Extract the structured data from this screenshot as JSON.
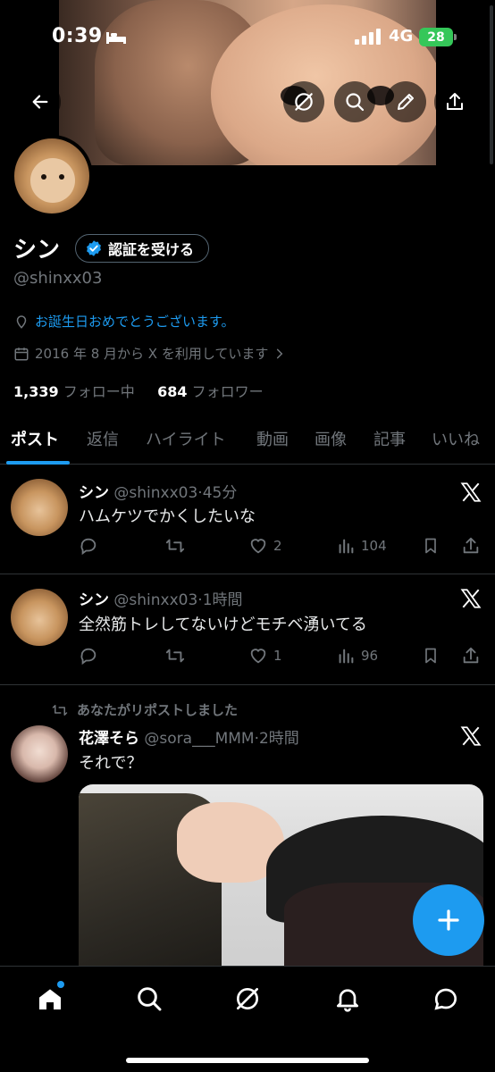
{
  "status_bar": {
    "time": "0:39",
    "network": "4G",
    "battery": "28"
  },
  "profile": {
    "name": "シン",
    "verify_label": "認証を受ける",
    "handle": "@shinxx03",
    "birthday": "お誕生日おめでとうございます。",
    "joined": "2016 年 8 月から X を利用しています",
    "following_count": "1,339",
    "following_label": "フォロー中",
    "followers_count": "684",
    "followers_label": "フォロワー"
  },
  "tabs": [
    {
      "label": "ポスト",
      "active": true
    },
    {
      "label": "返信"
    },
    {
      "label": "ハイライト"
    },
    {
      "label": "動画"
    },
    {
      "label": "画像"
    },
    {
      "label": "記事"
    },
    {
      "label": "いいね"
    }
  ],
  "posts": [
    {
      "name": "シン",
      "handle": "@shinxx03",
      "time": "45分",
      "text": "ハムケツでかくしたいな",
      "likes": "2",
      "views": "104"
    },
    {
      "name": "シン",
      "handle": "@shinxx03",
      "time": "1時間",
      "text": "全然筋トレしてないけどモチベ湧いてる",
      "likes": "1",
      "views": "96"
    },
    {
      "repost_note": "あなたがリポストしました",
      "name": "花澤そら",
      "handle": "@sora___MMM",
      "time": "2時間",
      "text": "それで？"
    }
  ],
  "colors": {
    "accent": "#1d9bf0",
    "muted": "#71767b",
    "battery": "#35c759"
  },
  "icons": [
    "back-icon",
    "grok-icon",
    "search-icon",
    "edit-icon",
    "share-icon",
    "verified-badge-icon",
    "location-pin-icon",
    "calendar-icon",
    "x-logo-icon",
    "reply-icon",
    "repost-icon",
    "like-icon",
    "views-icon",
    "bookmark-icon",
    "home-icon",
    "bell-icon",
    "messages-icon",
    "plus-icon"
  ]
}
